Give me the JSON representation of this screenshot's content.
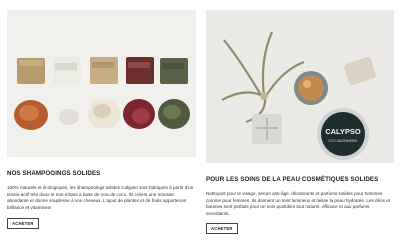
{
  "left_card": {
    "title": "NOS SHAMPOOINGS SOLIDES",
    "description": "100% naturels et écologiques, les shampooings solides Calypso sont fabriqués à partir d'un tensio-actif très doux et non-irritant à base de noix de coco. Ils créent une mousse abondante et donne souplesse à vos cheveux. L'ajout de plantes et de fruits apporteront brillance et vitamines!",
    "button_label": "ACHETER"
  },
  "right_card": {
    "title": "POUR LES SOINS DE LA PEAU COSMÉTIQUES SOLIDES",
    "description": "Nettoyant pour le visage, sérum anti-âge, déodorants et parfums solides pour hommes comme pour femmes. Ils donnent un teint lumineux et laisse la peau hydratée. Les déos et baumes sont parfaits pour un soin quotidien tout naturel, efficace et aux parfums envoûtants.",
    "button_label": "ACHETER",
    "tin_label": "CALYPSO",
    "tin_sublabel": "ECO-SAVONNERIE"
  }
}
